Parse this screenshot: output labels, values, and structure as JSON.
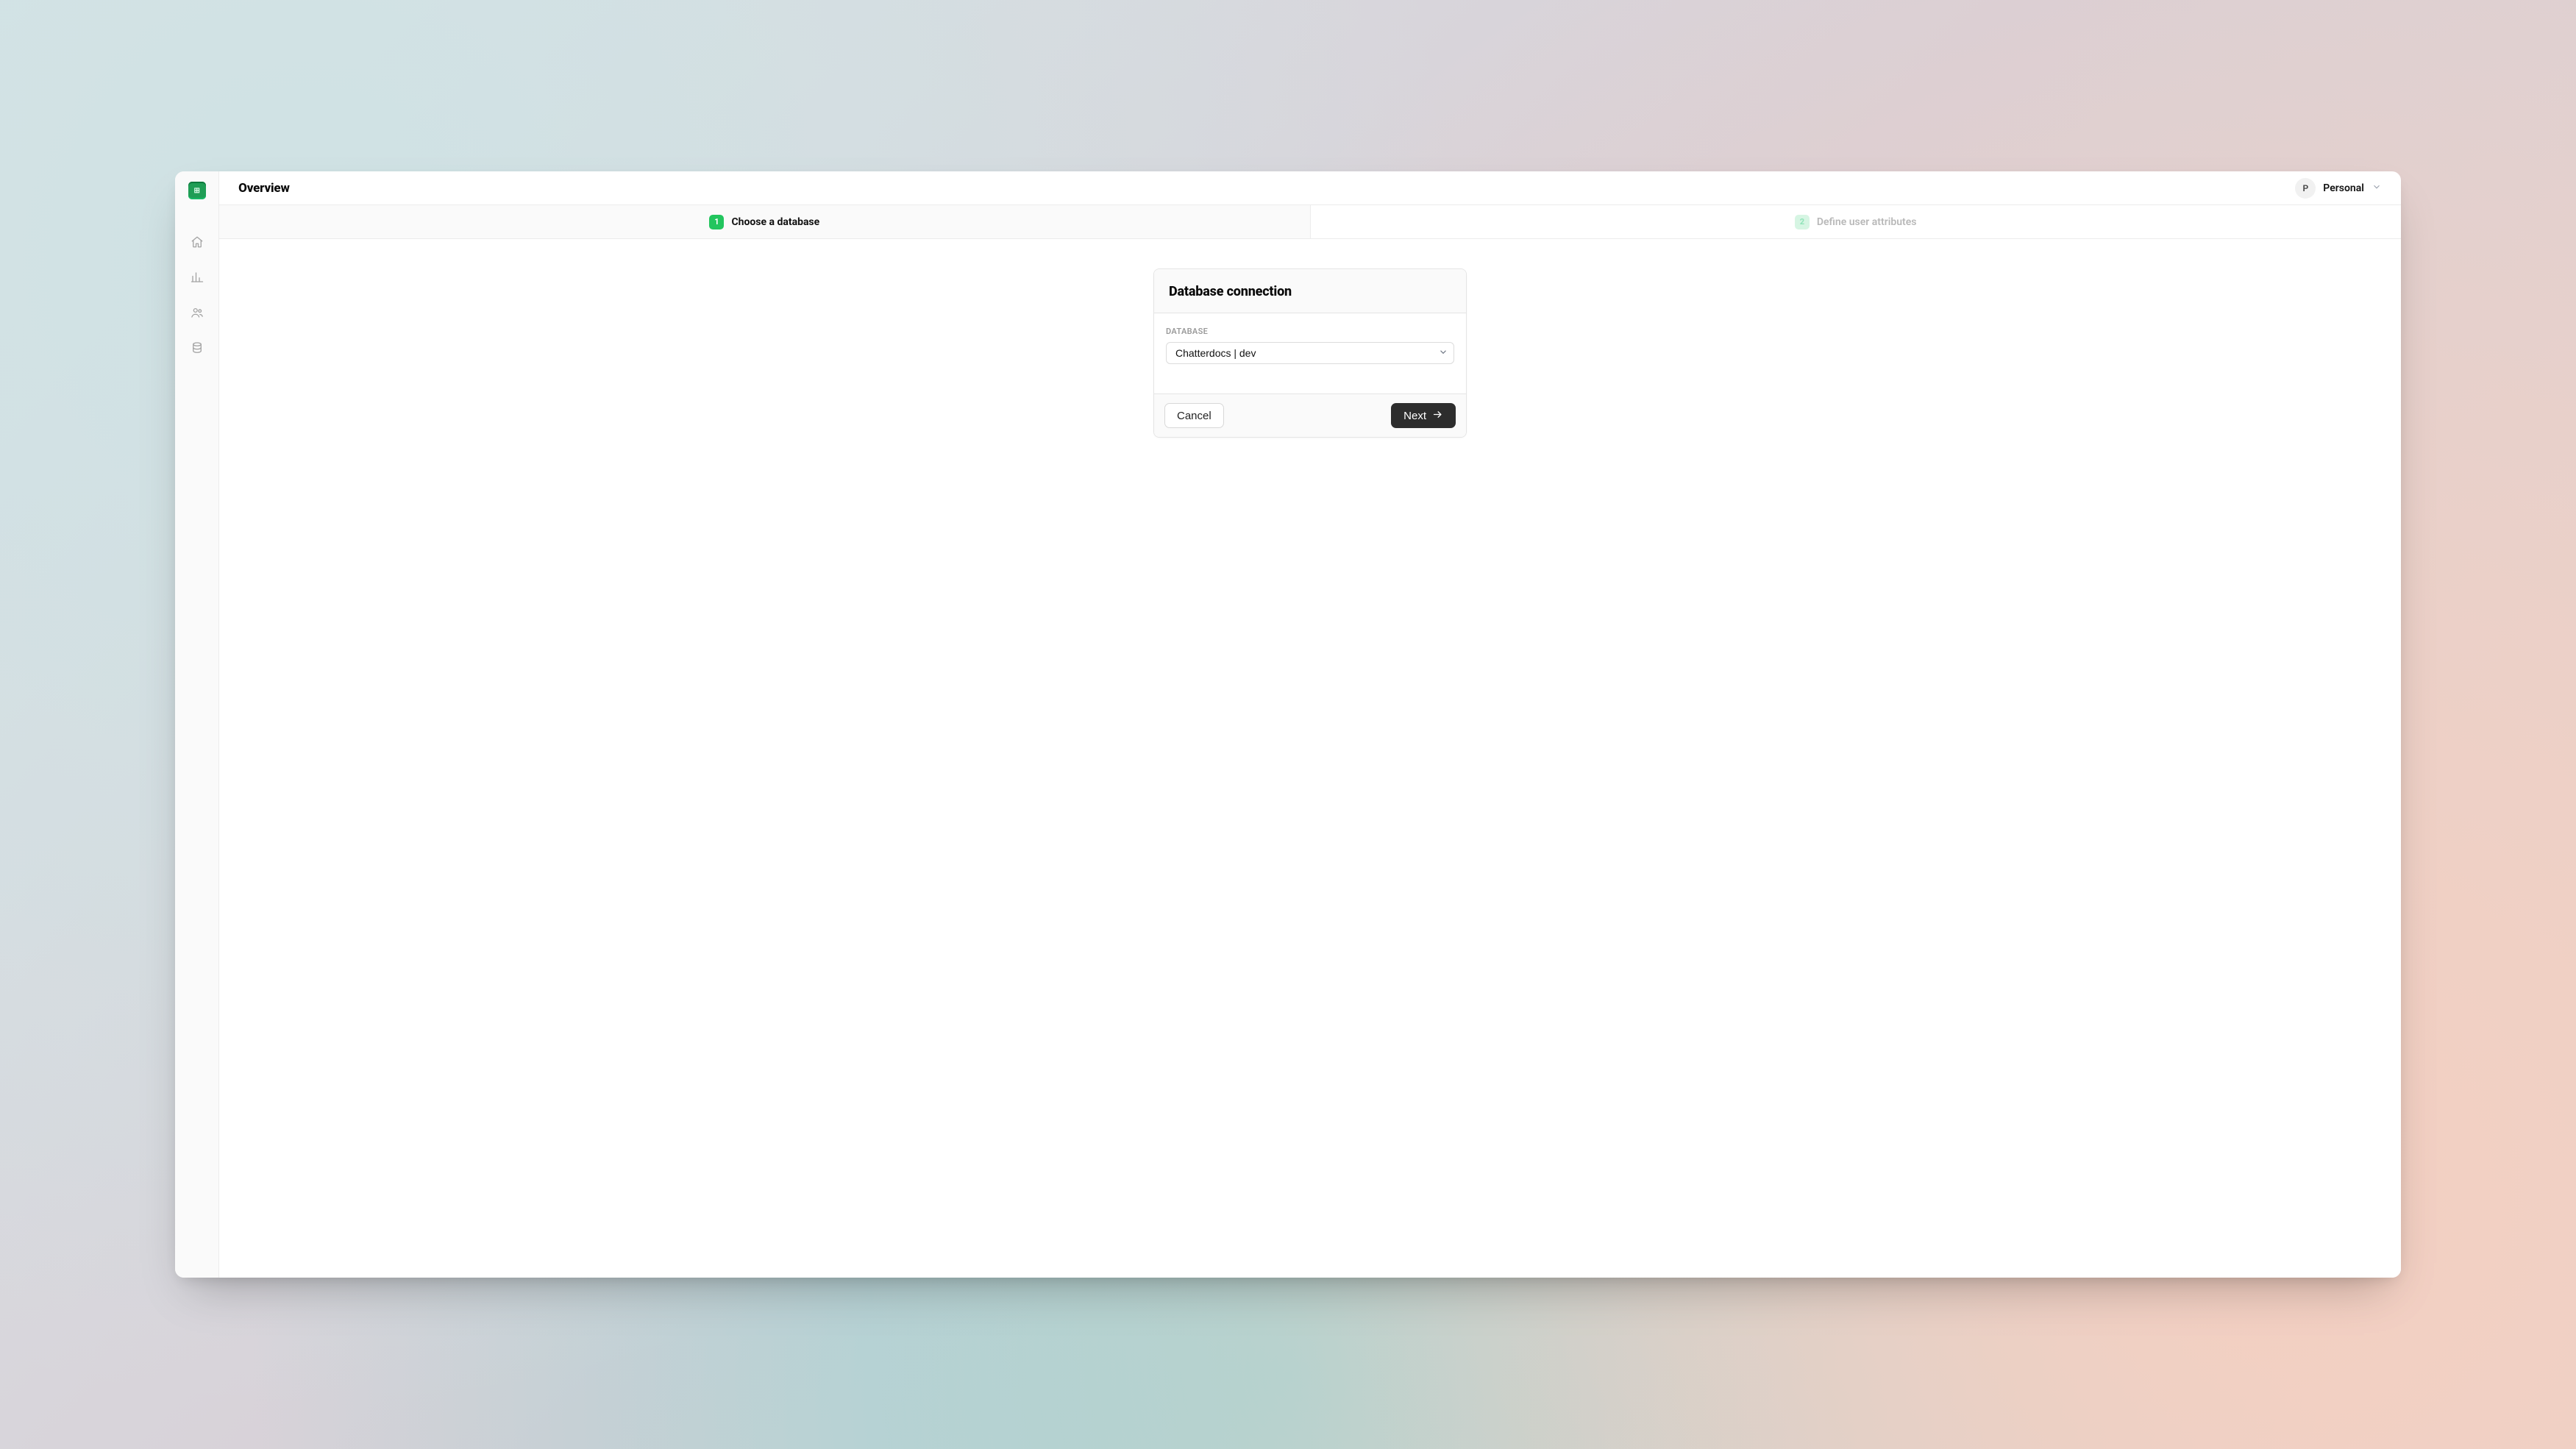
{
  "header": {
    "title": "Overview",
    "account": {
      "avatar_initial": "P",
      "label": "Personal"
    }
  },
  "stepper": {
    "step1": {
      "number": "1",
      "label": "Choose a database"
    },
    "step2": {
      "number": "2",
      "label": "Define user attributes"
    }
  },
  "card": {
    "title": "Database connection",
    "database": {
      "label": "DATABASE",
      "selected": "Chatterdocs | dev"
    },
    "buttons": {
      "cancel": "Cancel",
      "next": "Next"
    }
  }
}
